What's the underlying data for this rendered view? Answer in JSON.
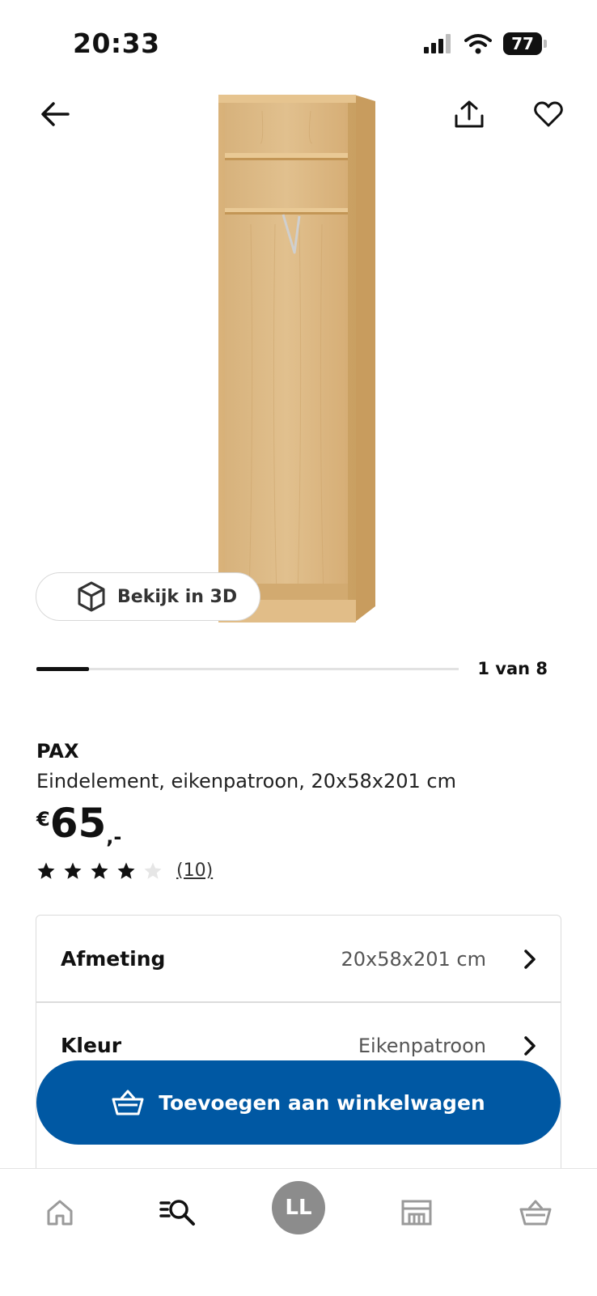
{
  "status_bar": {
    "time": "20:33",
    "battery": "77",
    "icons": [
      "signal-icon",
      "wifi-icon",
      "battery-icon"
    ]
  },
  "header": {
    "icons": [
      "back-arrow-icon",
      "share-icon",
      "heart-icon"
    ]
  },
  "gallery": {
    "view_3d_label": "Bekijk in 3D",
    "counter": "1 van 8",
    "progress": 0.125
  },
  "product": {
    "name": "PAX",
    "description": "Eindelement, eikenpatroon, 20x58x201 cm",
    "price": {
      "currency": "€",
      "amount": "65",
      "suffix": ",-"
    },
    "rating": {
      "stars": 4,
      "max": 5,
      "count": "(10)"
    }
  },
  "options": [
    {
      "label": "Afmeting",
      "value": "20x58x201 cm"
    },
    {
      "label": "Kleur",
      "value": "Eikenpatroon"
    }
  ],
  "cta": {
    "label": "Toevoegen aan winkelwagen",
    "color": "#0058a3"
  },
  "bottom_nav": {
    "avatar_initials": "LL",
    "items": [
      "home-icon",
      "search-icon",
      "avatar",
      "store-icon",
      "cart-icon"
    ]
  }
}
